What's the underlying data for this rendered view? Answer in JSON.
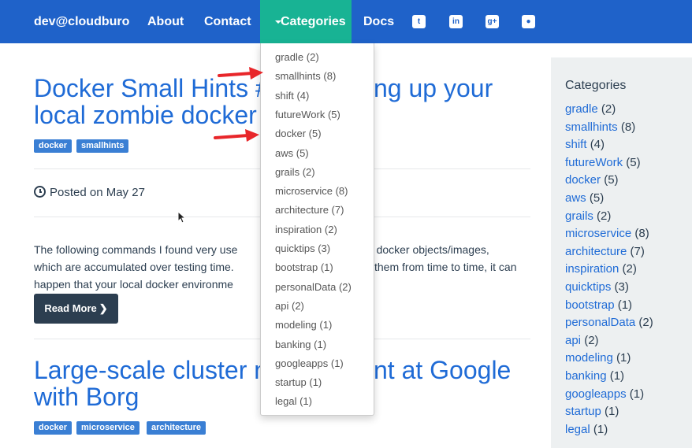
{
  "nav": {
    "brand": "dev@cloudburo",
    "about": "About",
    "contact": "Contact",
    "categories": "Categories",
    "docs": "Docs",
    "social": [
      "twitter-icon",
      "linkedin-icon",
      "googleplus-icon",
      "github-icon"
    ]
  },
  "dropdown": [
    {
      "label": "gradle",
      "count": "(2)"
    },
    {
      "label": "smallhints",
      "count": "(8)"
    },
    {
      "label": "shift",
      "count": "(4)"
    },
    {
      "label": "futureWork",
      "count": "(5)"
    },
    {
      "label": "docker",
      "count": "(5)"
    },
    {
      "label": "aws",
      "count": "(5)"
    },
    {
      "label": "grails",
      "count": "(2)"
    },
    {
      "label": "microservice",
      "count": "(8)"
    },
    {
      "label": "architecture",
      "count": "(7)"
    },
    {
      "label": "inspiration",
      "count": "(2)"
    },
    {
      "label": "quicktips",
      "count": "(3)"
    },
    {
      "label": "bootstrap",
      "count": "(1)"
    },
    {
      "label": "personalData",
      "count": "(2)"
    },
    {
      "label": "api",
      "count": "(2)"
    },
    {
      "label": "modeling",
      "count": "(1)"
    },
    {
      "label": "banking",
      "count": "(1)"
    },
    {
      "label": "googleapps",
      "count": "(1)"
    },
    {
      "label": "startup",
      "count": "(1)"
    },
    {
      "label": "legal",
      "count": "(1)"
    }
  ],
  "post1": {
    "title_line1_left": "Docker Small Hints #",
    "title_line1_right": "ng up your",
    "title_line2": "local zombie docker",
    "tags": [
      "docker",
      "smallhints"
    ],
    "posted": "Posted on May 27",
    "excerpt_l1_left": "The following commands I found very use",
    "excerpt_l1_right": "bie docker objects/images,",
    "excerpt_l2_left": "which are accumulated over testing time.",
    "excerpt_l2_right": "them from time to time, it can",
    "excerpt_l3_left": "happen that your local docker environme",
    "read_more": "Read More"
  },
  "post2": {
    "title_line1_left": "Large-scale cluster m",
    "title_line1_right": "nt at Google",
    "title_line2": "with Borg",
    "tags": [
      "docker",
      "microservice",
      "architecture"
    ]
  },
  "sidebar": {
    "heading": "Categories",
    "items": [
      {
        "label": "gradle",
        "count": "(2)"
      },
      {
        "label": "smallhints",
        "count": "(8)"
      },
      {
        "label": "shift",
        "count": "(4)"
      },
      {
        "label": "futureWork",
        "count": "(5)"
      },
      {
        "label": "docker",
        "count": "(5)"
      },
      {
        "label": "aws",
        "count": "(5)"
      },
      {
        "label": "grails",
        "count": "(2)"
      },
      {
        "label": "microservice",
        "count": "(8)"
      },
      {
        "label": "architecture",
        "count": "(7)"
      },
      {
        "label": "inspiration",
        "count": "(2)"
      },
      {
        "label": "quicktips",
        "count": "(3)"
      },
      {
        "label": "bootstrap",
        "count": "(1)"
      },
      {
        "label": "personalData",
        "count": "(2)"
      },
      {
        "label": "api",
        "count": "(2)"
      },
      {
        "label": "modeling",
        "count": "(1)"
      },
      {
        "label": "banking",
        "count": "(1)"
      },
      {
        "label": "googleapps",
        "count": "(1)"
      },
      {
        "label": "startup",
        "count": "(1)"
      },
      {
        "label": "legal",
        "count": "(1)"
      }
    ]
  },
  "colors": {
    "navbar": "#1f62c9",
    "nav_active": "#18b394",
    "link": "#1f6bd6",
    "tag": "#3a7fd4",
    "arrow": "#e8262a"
  }
}
